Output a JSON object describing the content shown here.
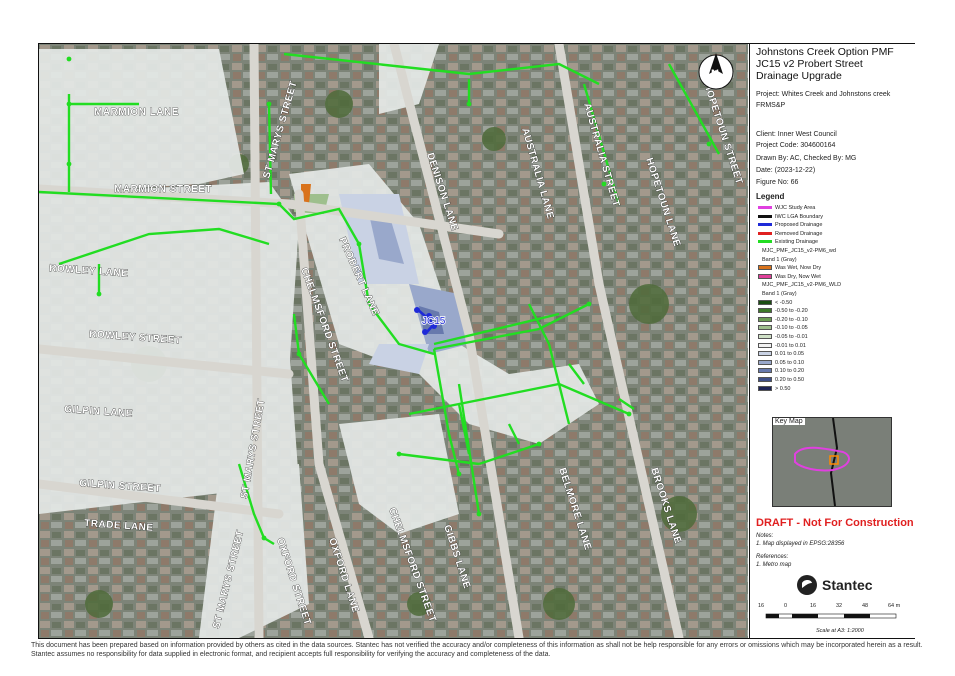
{
  "map": {
    "streets": [
      "MARMION LANE",
      "MARMION STREET",
      "ROWLEY LANE",
      "ROWLEY STREET",
      "GILPIN LANE",
      "GILPIN STREET",
      "TRADE LANE",
      "ST MARYS STREET",
      "ST MARYS STREET",
      "ST MARYS STREET",
      "CHELMSFORD STREET",
      "CHELMSFORD STREET",
      "PROBERT LANE",
      "DENISON LANE",
      "AUSTRALIA LANE",
      "AUSTRALIA STREET",
      "HOPETOUN LANE",
      "HOPETOUN STREET",
      "OXFORD STREET",
      "OXFORD LANE",
      "GIBBS LANE",
      "BELMORE LANE",
      "BROOKS LANE"
    ],
    "site_label": "JC15",
    "north_label": "N"
  },
  "panel": {
    "title": "Johnstons Creek Option PMF JC15 v2 Probert Street Drainage Upgrade",
    "project": "Project: Whites Creek and Johnstons creek FRMS&P",
    "client": "Client: Inner West Council",
    "project_code": "Project Code: 304600164",
    "drawn_by": "Drawn By: AC, Checked By: MG",
    "date": "Date: (2023-12-22)",
    "figure": "Figure No: 66",
    "legend_title": "Legend",
    "legend": [
      {
        "label": "WJC Study Area",
        "color": "#e040e0"
      },
      {
        "label": "IWC LGA Boundary",
        "color": "#111111"
      },
      {
        "label": "Proposed Drainage",
        "color": "#1e2ad8"
      },
      {
        "label": "Removed Drainage",
        "color": "#e02020"
      },
      {
        "label": "Existing Drainage",
        "color": "#22dd22"
      },
      {
        "label": "MJC_PMF_JC15_v2-PM6_wd",
        "color": ""
      },
      {
        "label": "Band 1 (Gray)",
        "color": ""
      },
      {
        "label": "Was Wet, Now Dry",
        "color": "#d9731c"
      },
      {
        "label": "Was Dry, Now Wet",
        "color": "#e0409a"
      },
      {
        "label": "MJC_PMF_JC15_v2-PM6_WLD",
        "color": ""
      },
      {
        "label": "Band 1 (Gray)",
        "color": ""
      },
      {
        "label": "< -0.50",
        "color": "#1b4d12"
      },
      {
        "label": "-0.50 to -0.20",
        "color": "#3e7a2a"
      },
      {
        "label": "-0.20 to -0.10",
        "color": "#6c9e55"
      },
      {
        "label": "-0.10 to -0.05",
        "color": "#9ebf8d"
      },
      {
        "label": "-0.05 to -0.01",
        "color": "#cfe0c6"
      },
      {
        "label": "-0.01 to 0.01",
        "color": "#f2f2f2"
      },
      {
        "label": "0.01 to 0.05",
        "color": "#c9d2e4"
      },
      {
        "label": "0.05 to 0.10",
        "color": "#99a8cb"
      },
      {
        "label": "0.10 to 0.20",
        "color": "#6779ad"
      },
      {
        "label": "0.20 to 0.50",
        "color": "#3f4f88"
      },
      {
        "label": "> 0.50",
        "color": "#1d2356"
      }
    ],
    "key_map_label": "Key Map",
    "draft": "DRAFT - Not For Construction",
    "notes_title": "Notes:",
    "notes": "1. Map displayed in EPSG:28356",
    "refs_title": "References:",
    "refs": "1. Metro map",
    "logo_text": "Stantec",
    "scale_ticks": [
      "16",
      "0",
      "16",
      "32",
      "48",
      "64 m"
    ],
    "scale_text": "Scale at A3: 1:2000"
  },
  "disclaimer": "This document has been prepared based on information provided by others as cited in the data sources. Stantec has not verified the accuracy and/or completeness of this information as shall not be help responsible for any errors or omissions which may be incorporated herein as a result. Stantec assumes no responsibility for data supplied in electronic format, and recipient accepts full responsibility for verifying the accuracy and completeness of the data."
}
